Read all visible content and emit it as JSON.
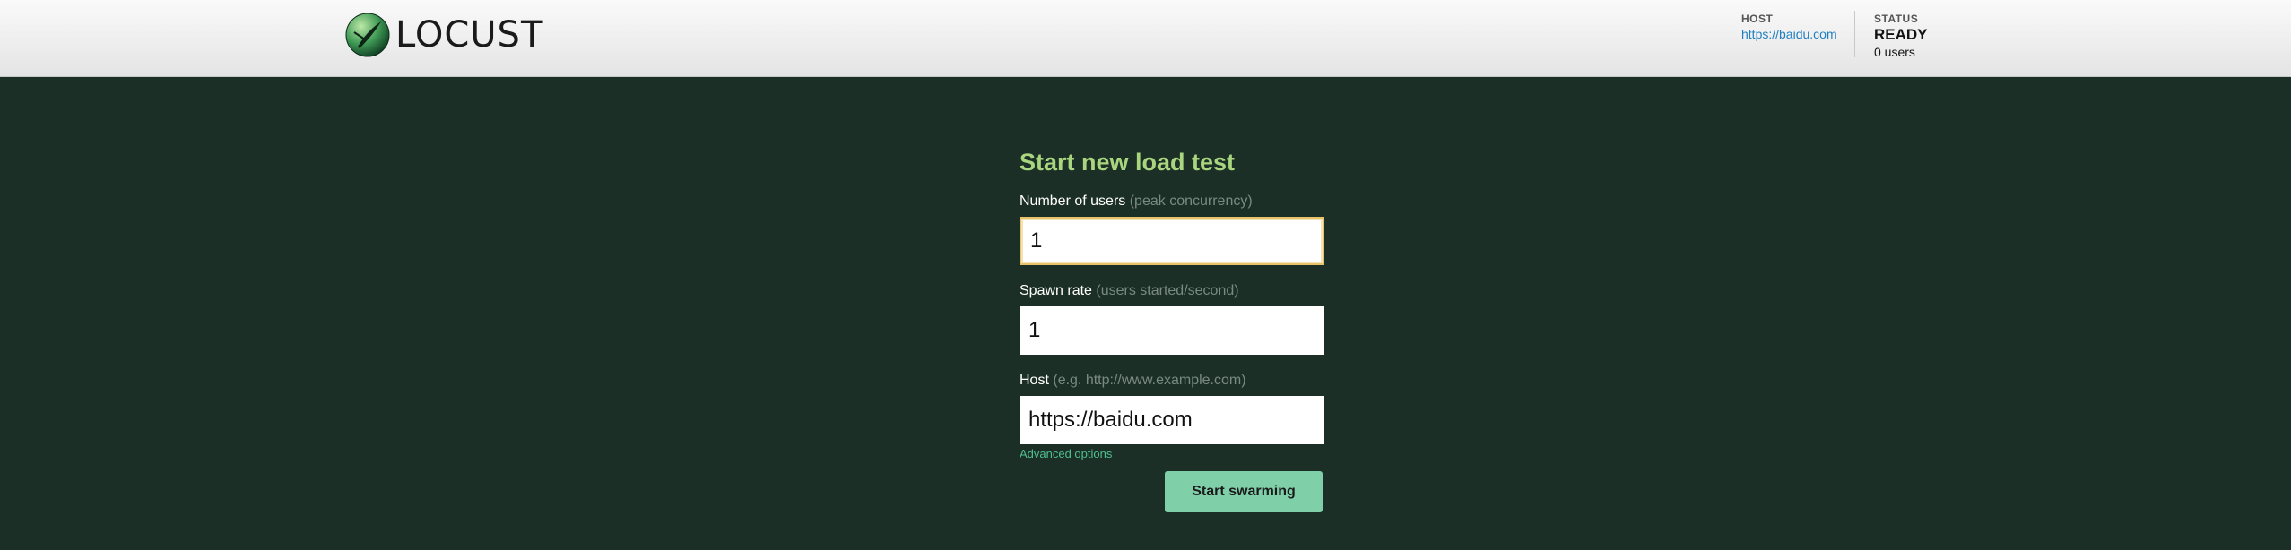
{
  "header": {
    "logo_text": "LOCUST",
    "host": {
      "label": "HOST",
      "value": "https://baidu.com"
    },
    "status": {
      "label": "STATUS",
      "state": "READY",
      "users": "0 users"
    }
  },
  "form": {
    "title": "Start new load test",
    "users": {
      "label": "Number of users",
      "hint": "(peak concurrency)",
      "value": "1"
    },
    "spawn_rate": {
      "label": "Spawn rate",
      "hint": "(users started/second)",
      "value": "1"
    },
    "host": {
      "label": "Host",
      "hint": "(e.g. http://www.example.com)",
      "value": "https://baidu.com"
    },
    "advanced_link": "Advanced options",
    "submit_label": "Start swarming"
  },
  "colors": {
    "background": "#1b2f26",
    "title": "#a9d57f",
    "button": "#7fcfa9",
    "link": "#4fbf8f"
  }
}
